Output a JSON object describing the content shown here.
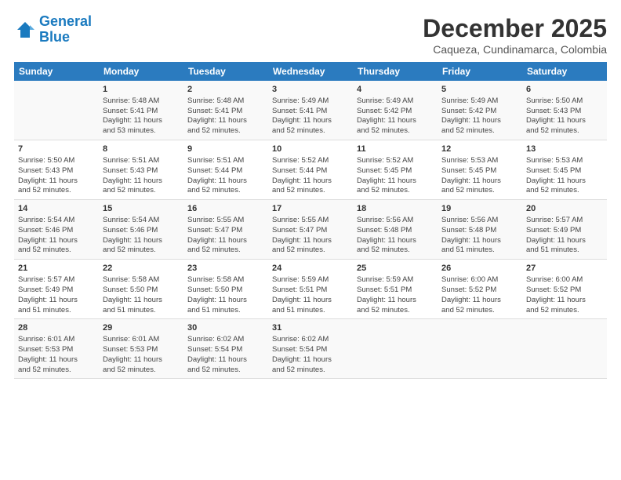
{
  "logo": {
    "line1": "General",
    "line2": "Blue"
  },
  "title": "December 2025",
  "subtitle": "Caqueza, Cundinamarca, Colombia",
  "header_days": [
    "Sunday",
    "Monday",
    "Tuesday",
    "Wednesday",
    "Thursday",
    "Friday",
    "Saturday"
  ],
  "weeks": [
    [
      {
        "day": "",
        "info": ""
      },
      {
        "day": "1",
        "info": "Sunrise: 5:48 AM\nSunset: 5:41 PM\nDaylight: 11 hours\nand 53 minutes."
      },
      {
        "day": "2",
        "info": "Sunrise: 5:48 AM\nSunset: 5:41 PM\nDaylight: 11 hours\nand 52 minutes."
      },
      {
        "day": "3",
        "info": "Sunrise: 5:49 AM\nSunset: 5:41 PM\nDaylight: 11 hours\nand 52 minutes."
      },
      {
        "day": "4",
        "info": "Sunrise: 5:49 AM\nSunset: 5:42 PM\nDaylight: 11 hours\nand 52 minutes."
      },
      {
        "day": "5",
        "info": "Sunrise: 5:49 AM\nSunset: 5:42 PM\nDaylight: 11 hours\nand 52 minutes."
      },
      {
        "day": "6",
        "info": "Sunrise: 5:50 AM\nSunset: 5:43 PM\nDaylight: 11 hours\nand 52 minutes."
      }
    ],
    [
      {
        "day": "7",
        "info": "Sunrise: 5:50 AM\nSunset: 5:43 PM\nDaylight: 11 hours\nand 52 minutes."
      },
      {
        "day": "8",
        "info": "Sunrise: 5:51 AM\nSunset: 5:43 PM\nDaylight: 11 hours\nand 52 minutes."
      },
      {
        "day": "9",
        "info": "Sunrise: 5:51 AM\nSunset: 5:44 PM\nDaylight: 11 hours\nand 52 minutes."
      },
      {
        "day": "10",
        "info": "Sunrise: 5:52 AM\nSunset: 5:44 PM\nDaylight: 11 hours\nand 52 minutes."
      },
      {
        "day": "11",
        "info": "Sunrise: 5:52 AM\nSunset: 5:45 PM\nDaylight: 11 hours\nand 52 minutes."
      },
      {
        "day": "12",
        "info": "Sunrise: 5:53 AM\nSunset: 5:45 PM\nDaylight: 11 hours\nand 52 minutes."
      },
      {
        "day": "13",
        "info": "Sunrise: 5:53 AM\nSunset: 5:45 PM\nDaylight: 11 hours\nand 52 minutes."
      }
    ],
    [
      {
        "day": "14",
        "info": "Sunrise: 5:54 AM\nSunset: 5:46 PM\nDaylight: 11 hours\nand 52 minutes."
      },
      {
        "day": "15",
        "info": "Sunrise: 5:54 AM\nSunset: 5:46 PM\nDaylight: 11 hours\nand 52 minutes."
      },
      {
        "day": "16",
        "info": "Sunrise: 5:55 AM\nSunset: 5:47 PM\nDaylight: 11 hours\nand 52 minutes."
      },
      {
        "day": "17",
        "info": "Sunrise: 5:55 AM\nSunset: 5:47 PM\nDaylight: 11 hours\nand 52 minutes."
      },
      {
        "day": "18",
        "info": "Sunrise: 5:56 AM\nSunset: 5:48 PM\nDaylight: 11 hours\nand 52 minutes."
      },
      {
        "day": "19",
        "info": "Sunrise: 5:56 AM\nSunset: 5:48 PM\nDaylight: 11 hours\nand 51 minutes."
      },
      {
        "day": "20",
        "info": "Sunrise: 5:57 AM\nSunset: 5:49 PM\nDaylight: 11 hours\nand 51 minutes."
      }
    ],
    [
      {
        "day": "21",
        "info": "Sunrise: 5:57 AM\nSunset: 5:49 PM\nDaylight: 11 hours\nand 51 minutes."
      },
      {
        "day": "22",
        "info": "Sunrise: 5:58 AM\nSunset: 5:50 PM\nDaylight: 11 hours\nand 51 minutes."
      },
      {
        "day": "23",
        "info": "Sunrise: 5:58 AM\nSunset: 5:50 PM\nDaylight: 11 hours\nand 51 minutes."
      },
      {
        "day": "24",
        "info": "Sunrise: 5:59 AM\nSunset: 5:51 PM\nDaylight: 11 hours\nand 51 minutes."
      },
      {
        "day": "25",
        "info": "Sunrise: 5:59 AM\nSunset: 5:51 PM\nDaylight: 11 hours\nand 52 minutes."
      },
      {
        "day": "26",
        "info": "Sunrise: 6:00 AM\nSunset: 5:52 PM\nDaylight: 11 hours\nand 52 minutes."
      },
      {
        "day": "27",
        "info": "Sunrise: 6:00 AM\nSunset: 5:52 PM\nDaylight: 11 hours\nand 52 minutes."
      }
    ],
    [
      {
        "day": "28",
        "info": "Sunrise: 6:01 AM\nSunset: 5:53 PM\nDaylight: 11 hours\nand 52 minutes."
      },
      {
        "day": "29",
        "info": "Sunrise: 6:01 AM\nSunset: 5:53 PM\nDaylight: 11 hours\nand 52 minutes."
      },
      {
        "day": "30",
        "info": "Sunrise: 6:02 AM\nSunset: 5:54 PM\nDaylight: 11 hours\nand 52 minutes."
      },
      {
        "day": "31",
        "info": "Sunrise: 6:02 AM\nSunset: 5:54 PM\nDaylight: 11 hours\nand 52 minutes."
      },
      {
        "day": "",
        "info": ""
      },
      {
        "day": "",
        "info": ""
      },
      {
        "day": "",
        "info": ""
      }
    ]
  ]
}
